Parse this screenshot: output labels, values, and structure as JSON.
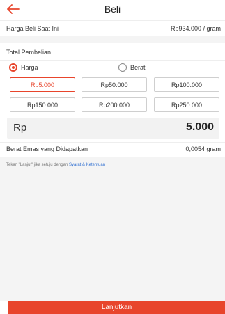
{
  "header": {
    "title": "Beli",
    "back_icon": "arrow-left-icon",
    "accent": "#e8452c"
  },
  "price_row": {
    "label": "Harga Beli Saat Ini",
    "value": "Rp934.000 / gram"
  },
  "total": {
    "label": "Total Pembelian"
  },
  "mode": {
    "options": [
      "Harga",
      "Berat"
    ],
    "selected": "Harga"
  },
  "amounts": [
    "Rp5.000",
    "Rp50.000",
    "Rp100.000",
    "Rp150.000",
    "Rp200.000",
    "Rp250.000"
  ],
  "selected_amount": "Rp5.000",
  "input": {
    "currency": "Rp",
    "value": "5.000"
  },
  "weight_row": {
    "label": "Berat Emas yang Didapatkan",
    "value": "0,0054 gram"
  },
  "terms": {
    "prefix": "Tekan \"Lanjut\" jika setuju dengan ",
    "link": "Syarat & Ketentuan"
  },
  "cta": {
    "label": "Lanjutkan"
  }
}
